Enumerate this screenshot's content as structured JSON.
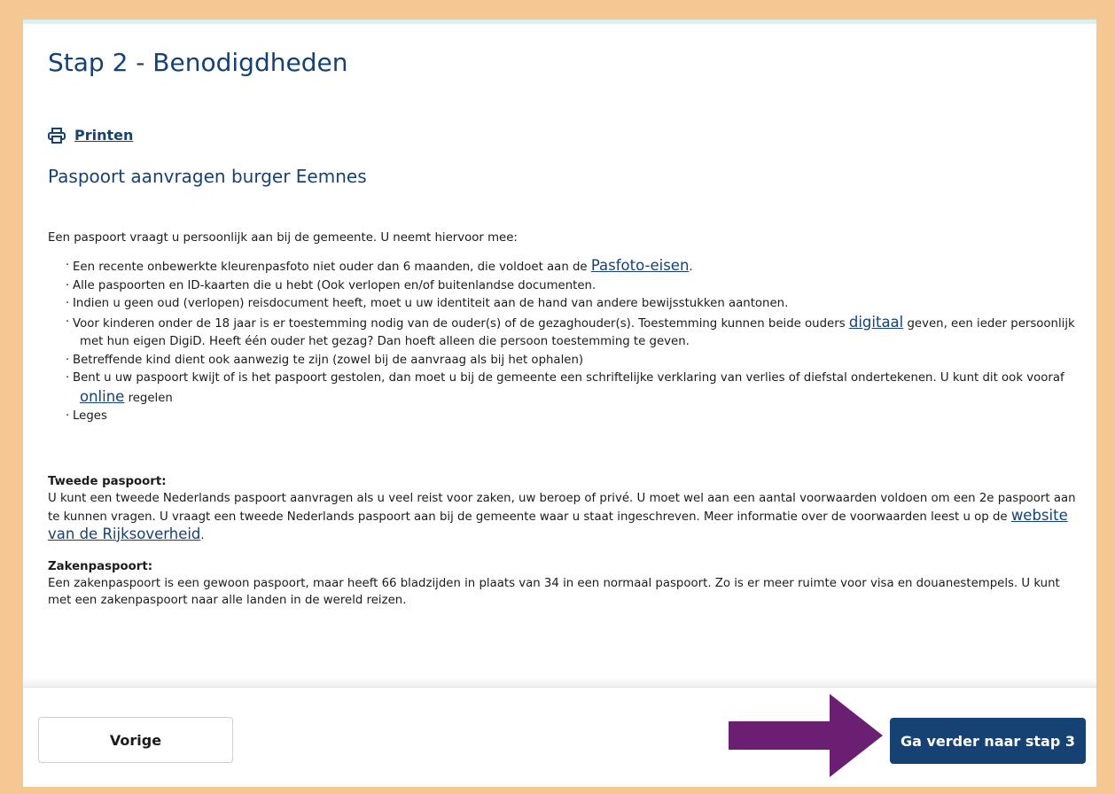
{
  "page": {
    "title": "Stap 2 - Benodigdheden",
    "print_label": "Printen",
    "subtitle": "Paspoort aanvragen burger Eemnes"
  },
  "intro": "Een paspoort vraagt u persoonlijk aan bij de gemeente. U neemt hiervoor mee:",
  "list": {
    "item1_text": "Een recente onbewerkte kleurenpasfoto niet ouder dan 6 maanden, die voldoet aan de ",
    "item1_link": "Pasfoto-eisen",
    "item1_after": ".",
    "item2": "Alle paspoorten en ID-kaarten die u hebt (Ook verlopen en/of buitenlandse documenten.",
    "item3": "Indien u geen oud (verlopen) reisdocument heeft, moet u uw identiteit aan de hand van andere bewijsstukken aantonen.",
    "item4_text": "Voor kinderen onder de 18 jaar is er toestemming nodig van de ouder(s) of de gezaghouder(s). Toestemming kunnen beide ouders ",
    "item4_link": "digitaal",
    "item4_after": " geven, een ieder persoonlijk met hun eigen DigiD. Heeft één ouder het gezag? Dan hoeft alleen die persoon toestemming te geven.",
    "item5": "Betreffende kind dient ook aanwezig te zijn (zowel bij de aanvraag als bij het ophalen)",
    "item6_text": "Bent u uw paspoort kwijt of is het paspoort gestolen, dan moet u bij de gemeente een schriftelijke verklaring van verlies of diefstal ondertekenen. U kunt dit ook vooraf ",
    "item6_link": "online",
    "item6_after": " regelen",
    "item7": "Leges",
    "bullet": "·"
  },
  "tweede": {
    "heading": "Tweede paspoort:",
    "text": "U kunt een tweede Nederlands paspoort aanvragen als u veel reist voor zaken, uw beroep of privé. U moet wel aan een aantal voorwaarden voldoen om een 2e paspoort aan te kunnen vragen. U vraagt een tweede Nederlands paspoort aan bij de gemeente waar u staat ingeschreven. Meer informatie over de voorwaarden leest u op de ",
    "link": "website van de Rijksoverheid",
    "after": "."
  },
  "zaken": {
    "heading": "Zakenpaspoort:",
    "text": "Een zakenpaspoort is een gewoon paspoort, maar heeft 66 bladzijden in plaats van 34 in een normaal paspoort. Zo is er meer ruimte voor visa en douanestempels. U kunt met een zakenpaspoort naar alle landen in de wereld reizen."
  },
  "footer": {
    "prev_label": "Vorige",
    "next_label": "Ga verder naar stap 3"
  },
  "icons": {
    "print": "printer-icon",
    "arrow": "right-arrow-annotation"
  },
  "colors": {
    "primary": "#154273",
    "frame": "#f5c893",
    "arrow": "#6b1f73"
  }
}
